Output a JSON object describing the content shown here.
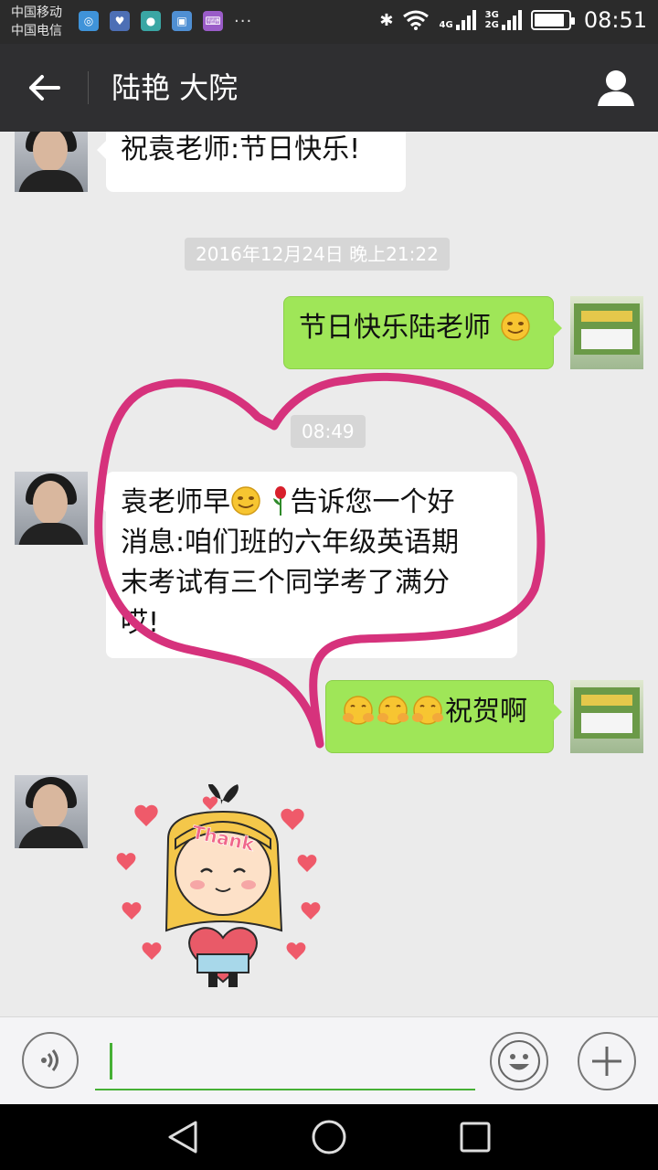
{
  "status_bar": {
    "carrier_1": "中国移动",
    "carrier_2": "中国电信",
    "more_indicator": "···",
    "net_1": "4G",
    "net_2a": "3G",
    "net_2b": "2G",
    "time": "08:51",
    "battery_level": 0.9
  },
  "header": {
    "title": "陆艳 大院"
  },
  "messages": [
    {
      "from": "other",
      "text": "祝袁老师:节日快乐!"
    },
    {
      "type": "time",
      "text": "2016年12月24日 晚上21:22"
    },
    {
      "from": "me",
      "text": "节日快乐陆老师"
    },
    {
      "type": "time",
      "text": "08:49"
    },
    {
      "from": "other",
      "line_1": "袁老师早",
      "line_1b": "告诉您一个好",
      "line_2": "消息:咱们班的六年级英语期",
      "line_3": "末考试有三个同学考了满分",
      "line_4": "哎!"
    },
    {
      "from": "me",
      "text": "祝贺啊"
    },
    {
      "from": "other",
      "type": "sticker",
      "sticker_text": "Thank"
    }
  ],
  "colors": {
    "bubble_out": "#9fe658",
    "bubble_in": "#ffffff",
    "heart_stroke": "#d6327c",
    "accent_green": "#46b035",
    "header_bg": "#2f2f31"
  }
}
